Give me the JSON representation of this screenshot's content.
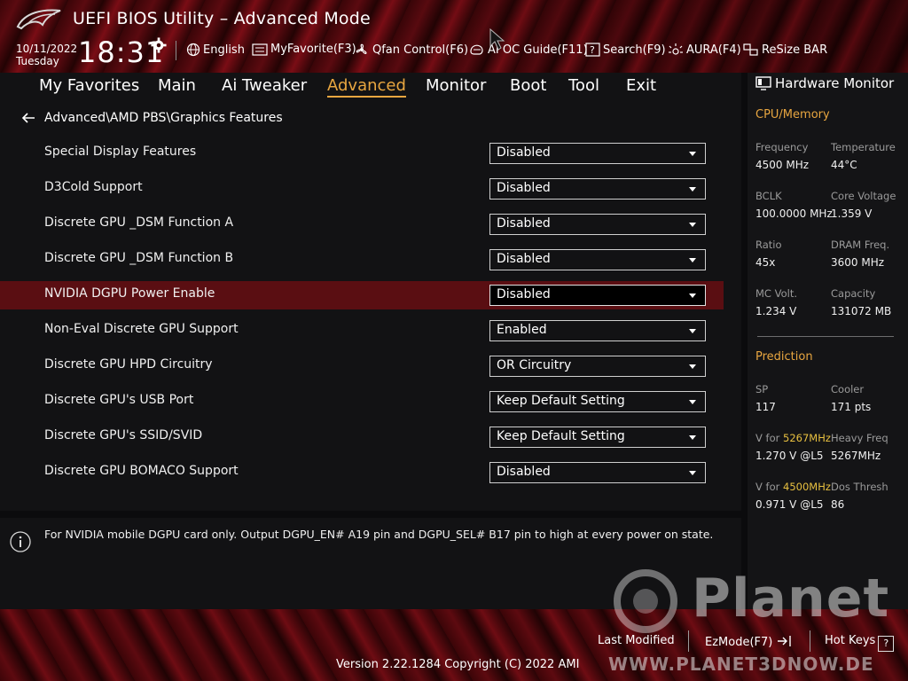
{
  "header": {
    "title": "UEFI BIOS Utility – Advanced Mode",
    "date": "10/11/2022",
    "day": "Tuesday",
    "time": "18:31",
    "toolbar": [
      {
        "icon": "globe-icon",
        "label": "English"
      },
      {
        "icon": "favorite-icon",
        "label": "MyFavorite(F3)"
      },
      {
        "icon": "fan-icon",
        "label": "Qfan Control(F6)"
      },
      {
        "icon": "oc-guide-icon",
        "label": "AI OC Guide(F11)"
      },
      {
        "icon": "search-icon",
        "label": "Search(F9)"
      },
      {
        "icon": "aura-icon",
        "label": "AURA(F4)"
      },
      {
        "icon": "resize-bar-icon",
        "label": "ReSize BAR"
      }
    ]
  },
  "menu": {
    "items": [
      "My Favorites",
      "Main",
      "Ai Tweaker",
      "Advanced",
      "Monitor",
      "Boot",
      "Tool",
      "Exit"
    ],
    "active": "Advanced"
  },
  "breadcrumb": "Advanced\\AMD PBS\\Graphics Features",
  "settings": [
    {
      "label": "Special Display Features",
      "value": "Disabled"
    },
    {
      "label": "D3Cold Support",
      "value": "Disabled"
    },
    {
      "label": "Discrete GPU _DSM Function A",
      "value": "Disabled"
    },
    {
      "label": "Discrete GPU _DSM Function B",
      "value": "Disabled"
    },
    {
      "label": "NVIDIA DGPU Power Enable",
      "value": "Disabled",
      "selected": true
    },
    {
      "label": "Non-Eval Discrete GPU Support",
      "value": "Enabled"
    },
    {
      "label": "Discrete GPU HPD Circuitry",
      "value": "OR Circuitry"
    },
    {
      "label": "Discrete GPU's USB Port",
      "value": "Keep Default Setting"
    },
    {
      "label": "Discrete GPU's SSID/SVID",
      "value": "Keep Default Setting"
    },
    {
      "label": "Discrete GPU BOMACO Support",
      "value": "Disabled"
    }
  ],
  "help": {
    "text": "For NVIDIA mobile DGPU card only. Output DGPU_EN# A19 pin and DGPU_SEL# B17 pin to high at every power on state."
  },
  "monitor": {
    "title": "Hardware Monitor",
    "cpu_memory": {
      "section": "CPU/Memory",
      "frequency_label": "Frequency",
      "frequency": "4500 MHz",
      "temperature_label": "Temperature",
      "temperature": "44°C",
      "bclk_label": "BCLK",
      "bclk": "100.0000 MHz",
      "core_voltage_label": "Core Voltage",
      "core_voltage": "1.359 V",
      "ratio_label": "Ratio",
      "ratio": "45x",
      "dram_freq_label": "DRAM Freq.",
      "dram_freq": "3600 MHz",
      "mc_volt_label": "MC Volt.",
      "mc_volt": "1.234 V",
      "capacity_label": "Capacity",
      "capacity": "131072 MB"
    },
    "prediction": {
      "section": "Prediction",
      "sp_label": "SP",
      "sp": "117",
      "cooler_label": "Cooler",
      "cooler": "171 pts",
      "v_for_prefix": "V for ",
      "v_for_1_freq": "5267MHz",
      "v_for_1_value": "1.270 V @L5",
      "heavy_freq_label": "Heavy Freq",
      "heavy_freq": "5267MHz",
      "v_for_2_freq": "4500MHz",
      "v_for_2_value": "0.971 V @L5",
      "dos_thresh_label": "Dos Thresh",
      "dos_thresh": "86"
    }
  },
  "footer": {
    "last_modified": "Last Modified",
    "ezmode": "EzMode(F7)",
    "hot_keys": "Hot Keys",
    "hot_keys_key": "?",
    "version": "Version 2.22.1284 Copyright (C) 2022 AMI"
  },
  "watermark": {
    "big": "Planet",
    "url": "WWW.PLANET3DNOW.DE"
  },
  "colors": {
    "accent": "#e8a640",
    "highlight": "#e8c040",
    "selected_row": "#5a0e12"
  }
}
